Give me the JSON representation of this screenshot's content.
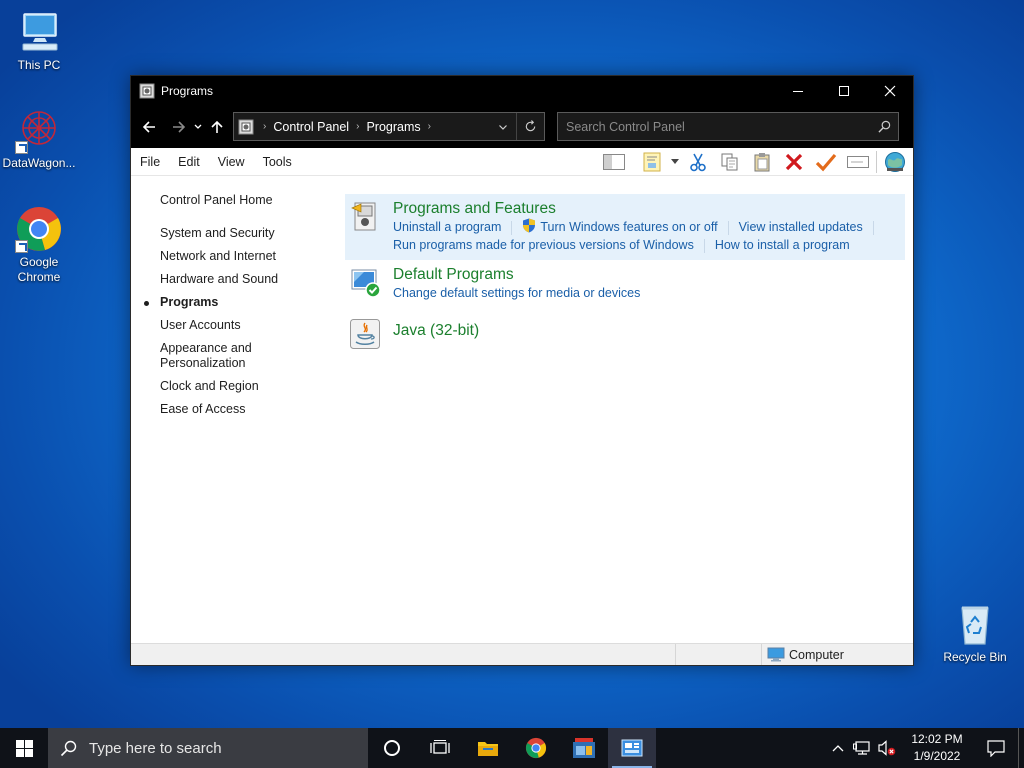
{
  "desktop": {
    "icons": [
      {
        "label": "This PC"
      },
      {
        "label": "DataWagon..."
      },
      {
        "label": "Google\nChrome"
      },
      {
        "label": "Recycle Bin"
      }
    ]
  },
  "window": {
    "title": "Programs",
    "address": {
      "crumbs": [
        "Control Panel",
        "Programs"
      ]
    },
    "search": {
      "placeholder": "Search Control Panel"
    },
    "menu": [
      "File",
      "Edit",
      "View",
      "Tools"
    ],
    "sidebar": {
      "home": "Control Panel Home",
      "items": [
        {
          "label": "System and Security"
        },
        {
          "label": "Network and Internet"
        },
        {
          "label": "Hardware and Sound"
        },
        {
          "label": "Programs"
        },
        {
          "label": "User Accounts"
        },
        {
          "label": "Appearance and Personalization"
        },
        {
          "label": "Clock and Region"
        },
        {
          "label": "Ease of Access"
        }
      ]
    },
    "categories": [
      {
        "title": "Programs and Features",
        "links_row1": [
          "Uninstall a program",
          "Turn Windows features on or off",
          "View installed updates"
        ],
        "links_row2": [
          "Run programs made for previous versions of Windows",
          "How to install a program"
        ]
      },
      {
        "title": "Default Programs",
        "links_row1": [
          "Change default settings for media or devices"
        ]
      },
      {
        "title": "Java (32-bit)"
      }
    ],
    "status": {
      "location": "Computer"
    }
  },
  "taskbar": {
    "search_placeholder": "Type here to search",
    "clock": {
      "time": "12:02 PM",
      "date": "1/9/2022"
    }
  },
  "colors": {
    "category_title": "#1b7f2d",
    "link": "#1a5fa8",
    "highlight": "#e5f1fb",
    "titlebar": "#000000",
    "taskbar": "#0f1218"
  }
}
